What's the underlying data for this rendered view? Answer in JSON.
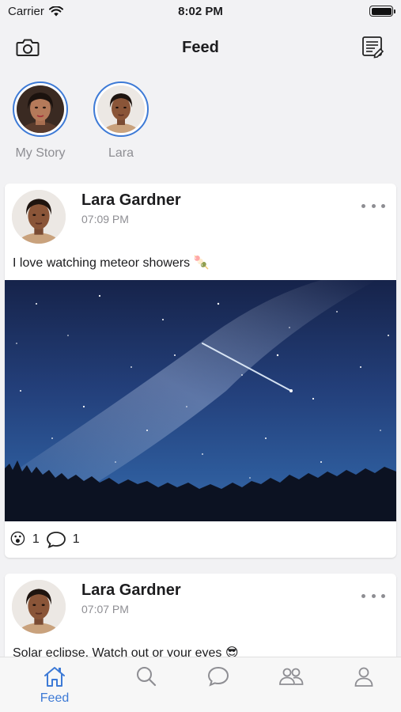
{
  "status_bar": {
    "carrier": "Carrier",
    "time": "8:02 PM"
  },
  "nav": {
    "title": "Feed",
    "left_icon": "camera-icon",
    "right_icon": "compose-icon"
  },
  "stories": [
    {
      "label": "My Story"
    },
    {
      "label": "Lara"
    }
  ],
  "posts": [
    {
      "author": "Lara Gardner",
      "time": "07:09 PM",
      "text": "I love watching meteor showers 🍡",
      "image_icon": "night-sky-meteor-image",
      "reaction_emoji": "😮",
      "reaction_count": "1",
      "comment_count": "1"
    },
    {
      "author": "Lara Gardner",
      "time": "07:07 PM",
      "text": "Solar eclipse. Watch out or your eyes 😎"
    }
  ],
  "tabs": [
    {
      "label": "Feed",
      "icon": "home-icon",
      "active": true
    },
    {
      "label": "",
      "icon": "search-icon"
    },
    {
      "label": "",
      "icon": "chat-icon"
    },
    {
      "label": "",
      "icon": "friends-icon"
    },
    {
      "label": "",
      "icon": "profile-icon"
    }
  ],
  "colors": {
    "accent": "#3d7ad6",
    "secondary_text": "#8e8e93",
    "background": "#f2f2f4"
  }
}
